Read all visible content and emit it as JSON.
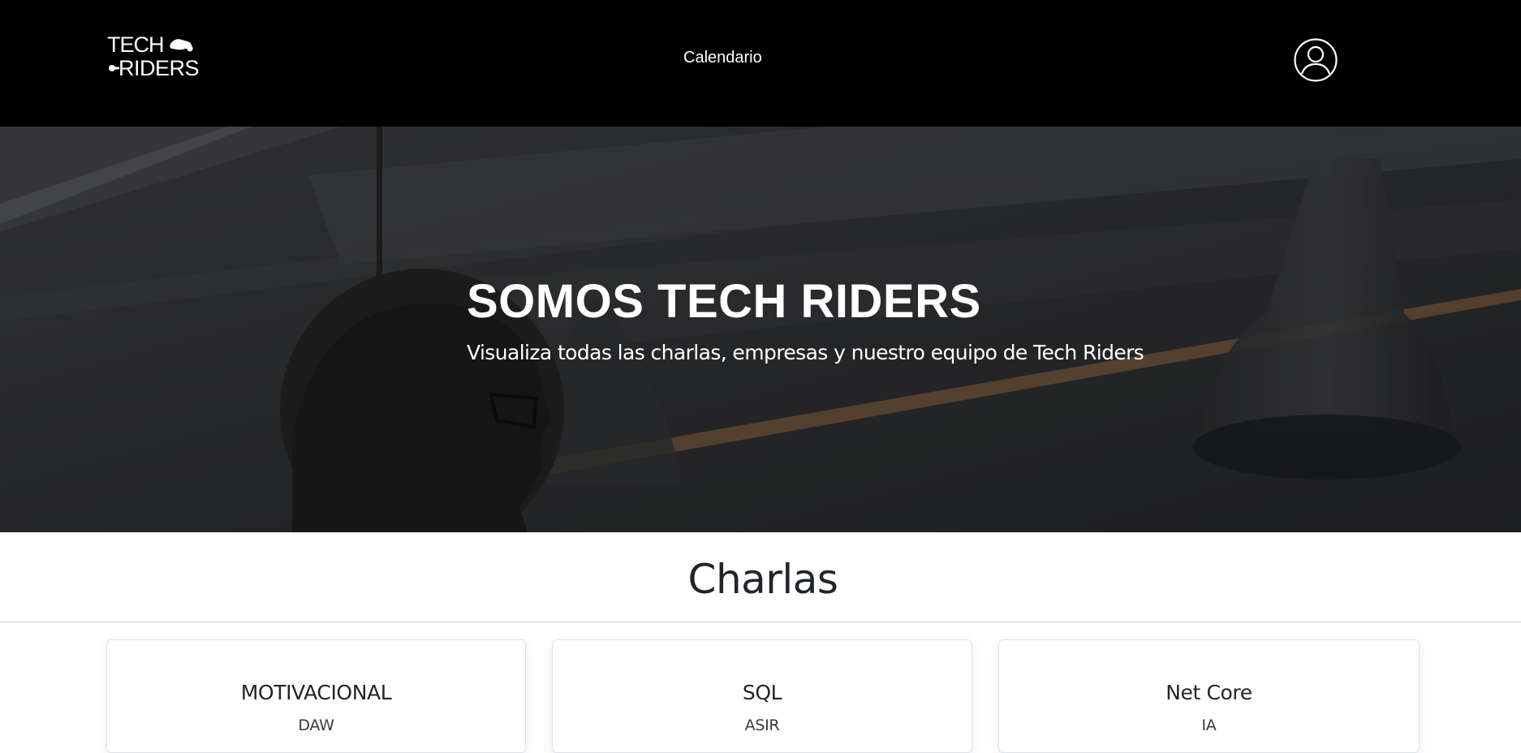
{
  "navbar": {
    "logo": {
      "icon": "tech-riders-logo",
      "line1": "TECH",
      "line2": "RIDERS"
    },
    "links": [
      {
        "label": "Calendario"
      }
    ],
    "user_icon": "user-circle-icon"
  },
  "hero": {
    "title": "SOMOS TECH RIDERS",
    "subtitle": "Visualiza todas las charlas, empresas y nuestro equipo de Tech Riders"
  },
  "charlas": {
    "heading": "Charlas",
    "cards": [
      {
        "title": "MOTIVACIONAL",
        "subtitle": "DAW"
      },
      {
        "title": "SQL",
        "subtitle": "ASIR"
      },
      {
        "title": "Net Core",
        "subtitle": "IA"
      }
    ]
  },
  "colors": {
    "navbar_bg": "#000000",
    "hero_overlay": "#2b2b2d",
    "text_dark": "#212529",
    "white": "#ffffff"
  }
}
